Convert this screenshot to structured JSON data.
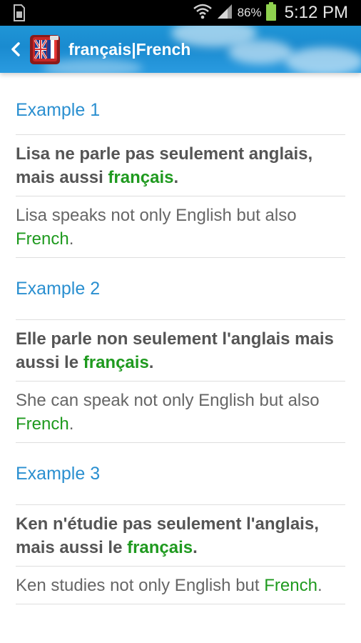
{
  "status_bar": {
    "battery_percent": "86%",
    "time": "5:12 PM"
  },
  "action_bar": {
    "title": "français|French"
  },
  "examples": [
    {
      "label": "Example 1",
      "french": {
        "before": "Lisa ne parle pas seulement anglais, mais aussi ",
        "highlight": "français",
        "after": "."
      },
      "english": {
        "before": "Lisa speaks not only English but also ",
        "highlight": "French",
        "after": "."
      }
    },
    {
      "label": "Example 2",
      "french": {
        "before": "Elle parle non seulement l'anglais mais aussi le ",
        "highlight": "français",
        "after": "."
      },
      "english": {
        "before": "She can speak not only English but also ",
        "highlight": "French",
        "after": "."
      }
    },
    {
      "label": "Example 3",
      "french": {
        "before": "Ken n'étudie pas seulement l'anglais, mais aussi le ",
        "highlight": "français",
        "after": "."
      },
      "english": {
        "before": "Ken studies not only English but ",
        "highlight": "French",
        "after": "."
      }
    }
  ],
  "colors": {
    "accent": "#2a8fd0",
    "highlight": "#1f9a1f",
    "action_bar": "#1f95d6"
  }
}
